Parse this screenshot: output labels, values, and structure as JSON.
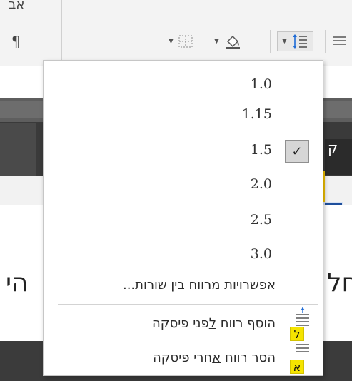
{
  "ribbon": {
    "top_text": "אב",
    "pilcrow": "¶"
  },
  "line_spacing_menu": {
    "options": [
      {
        "label": "1.0",
        "selected": false
      },
      {
        "label": "1.15",
        "selected": false
      },
      {
        "label": "1.5",
        "selected": true
      },
      {
        "label": "2.0",
        "selected": false
      },
      {
        "label": "2.5",
        "selected": false
      },
      {
        "label": "3.0",
        "selected": false
      }
    ],
    "options_link": "אפשרויות מרווח בין שורות...",
    "add_space_before": {
      "prefix": "הוסף רווח ",
      "underlined": "ל",
      "suffix": "פני פיסקה",
      "keytip": "ל"
    },
    "remove_space_after": {
      "prefix": "הסר רווח ",
      "underlined": "א",
      "suffix": "חרי פיסקה",
      "keytip": "א"
    },
    "check_glyph": "✓"
  },
  "document": {
    "left_text": "הי",
    "right_text": "חל",
    "card_right_char": "ק"
  },
  "colors": {
    "keytip": "#f5e400",
    "selected_bg": "#d6d6d6",
    "icon_blue": "#1e6bd6"
  }
}
